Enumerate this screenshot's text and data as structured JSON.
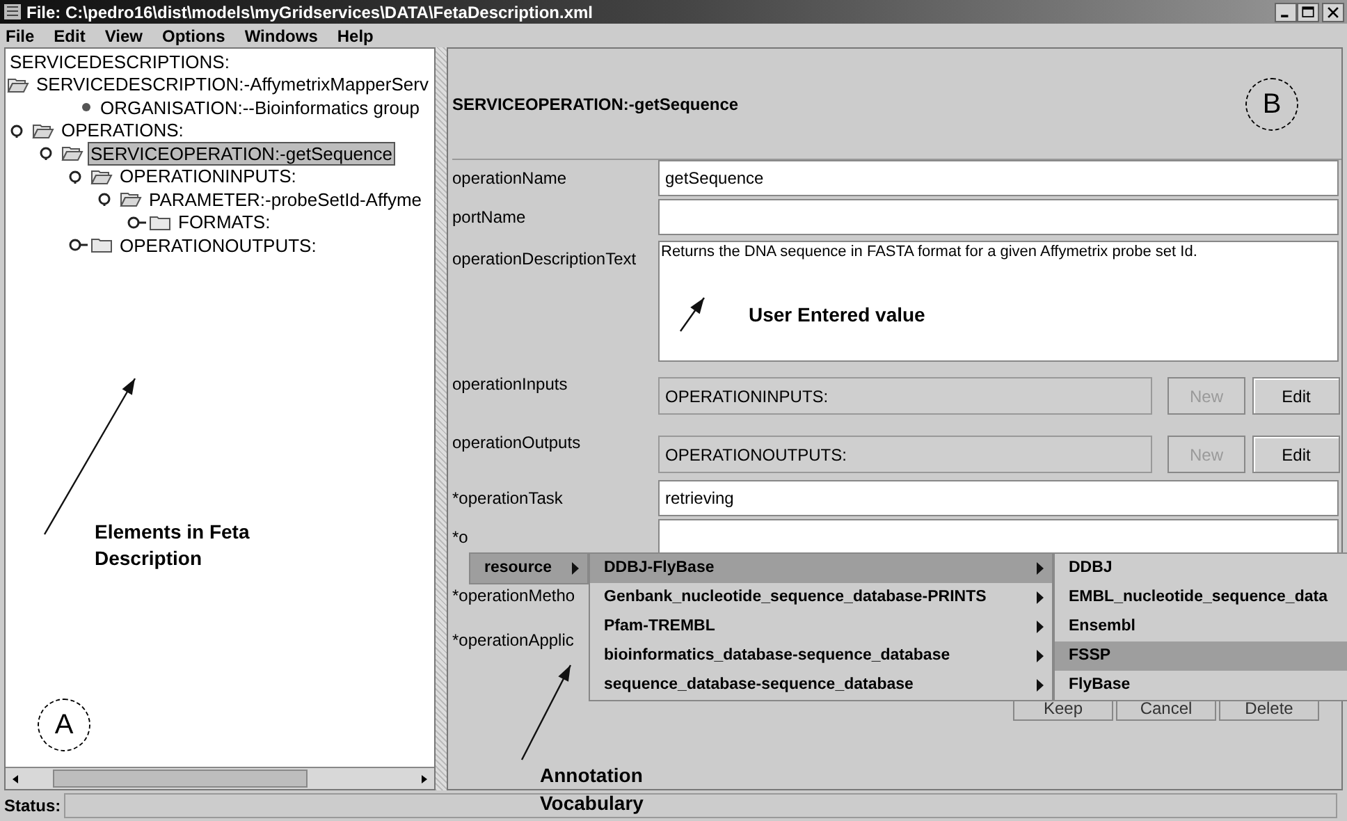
{
  "window": {
    "title": "File: C:\\pedro16\\dist\\models\\myGridservices\\DATA\\FetaDescription.xml"
  },
  "menu_bar": [
    "File",
    "Edit",
    "View",
    "Options",
    "Windows",
    "Help"
  ],
  "tree": {
    "label": "SERVICEDESCRIPTIONS:",
    "kind": "root",
    "children": [
      {
        "label": "SERVICEDESCRIPTION:-AffymetrixMapperServ",
        "kind": "folder",
        "open": true,
        "selected": false,
        "children": [
          {
            "label": "ORGANISATION:--Bioinformatics group",
            "kind": "leaf",
            "selected": false
          },
          {
            "label": "OPERATIONS:",
            "kind": "folder",
            "open": true,
            "expanded": true,
            "selected": false,
            "children": [
              {
                "label": "SERVICEOPERATION:-getSequence",
                "kind": "folder",
                "open": true,
                "expanded": true,
                "selected": true,
                "children": [
                  {
                    "label": "OPERATIONINPUTS:",
                    "kind": "folder",
                    "open": true,
                    "expanded": true,
                    "selected": false,
                    "children": [
                      {
                        "label": "PARAMETER:-probeSetId-Affyme",
                        "kind": "folder",
                        "open": true,
                        "expanded": true,
                        "selected": false,
                        "children": [
                          {
                            "label": "FORMATS:",
                            "kind": "folder",
                            "open": false,
                            "expanded": false,
                            "selected": false
                          }
                        ]
                      }
                    ]
                  },
                  {
                    "label": "OPERATIONOUTPUTS:",
                    "kind": "folder",
                    "open": false,
                    "expanded": false,
                    "selected": false
                  }
                ]
              }
            ]
          }
        ]
      }
    ]
  },
  "panel": {
    "title": "SERVICEOPERATION:-getSequence",
    "fields": [
      {
        "kind": "text",
        "label": "operationName",
        "value": "getSequence"
      },
      {
        "kind": "text",
        "label": "portName"
      },
      {
        "kind": "textarea",
        "label": "operationDescriptionText",
        "value": "Returns the DNA sequence in FASTA format for a given Affymetrix probe set Id."
      },
      {
        "kind": "reference",
        "label": "operationInputs",
        "value": "OPERATIONINPUTS:",
        "buttons": [
          {
            "label": "New",
            "disabled": true
          },
          {
            "label": "Edit",
            "disabled": false
          }
        ]
      },
      {
        "kind": "reference",
        "label": "operationOutputs",
        "value": "OPERATIONOUTPUTS:",
        "buttons": [
          {
            "label": "New",
            "disabled": true
          },
          {
            "label": "Edit",
            "disabled": false
          }
        ]
      },
      {
        "kind": "text",
        "label": "*operationTask",
        "value": "retrieving"
      },
      {
        "kind": "text",
        "label": "*o"
      },
      {
        "kind": "covered",
        "label": "*operationMetho"
      },
      {
        "kind": "covered",
        "label": "*operationApplic"
      }
    ],
    "actions": [
      "Keep",
      "Cancel",
      "Delete"
    ]
  },
  "popup": {
    "menu": [
      {
        "label": "resource",
        "selected": true,
        "has_submenu": true
      }
    ],
    "submenu": [
      {
        "label": "DDBJ-FlyBase",
        "selected": true,
        "has_submenu": true
      },
      {
        "label": "Genbank_nucleotide_sequence_database-PRINTS",
        "selected": false,
        "has_submenu": true
      },
      {
        "label": "Pfam-TREMBL",
        "selected": false,
        "has_submenu": true
      },
      {
        "label": "bioinformatics_database-sequence_database",
        "selected": false,
        "has_submenu": true
      },
      {
        "label": "sequence_database-sequence_database",
        "selected": false,
        "has_submenu": true
      }
    ],
    "subsubmenu": [
      {
        "label": "DDBJ",
        "selected": false,
        "has_submenu": false
      },
      {
        "label": "EMBL_nucleotide_sequence_data",
        "selected": false,
        "has_submenu": false
      },
      {
        "label": "Ensembl",
        "selected": false,
        "has_submenu": false
      },
      {
        "label": "FSSP",
        "selected": true,
        "has_submenu": false
      },
      {
        "label": "FlyBase",
        "selected": false,
        "has_submenu": false
      }
    ]
  },
  "status_bar": {
    "label": "Status:"
  },
  "annotations": {
    "callouts": [
      "A",
      "B"
    ],
    "notes": [
      "Elements in Feta Description",
      "User Entered value",
      "Annotation Vocabulary"
    ]
  }
}
